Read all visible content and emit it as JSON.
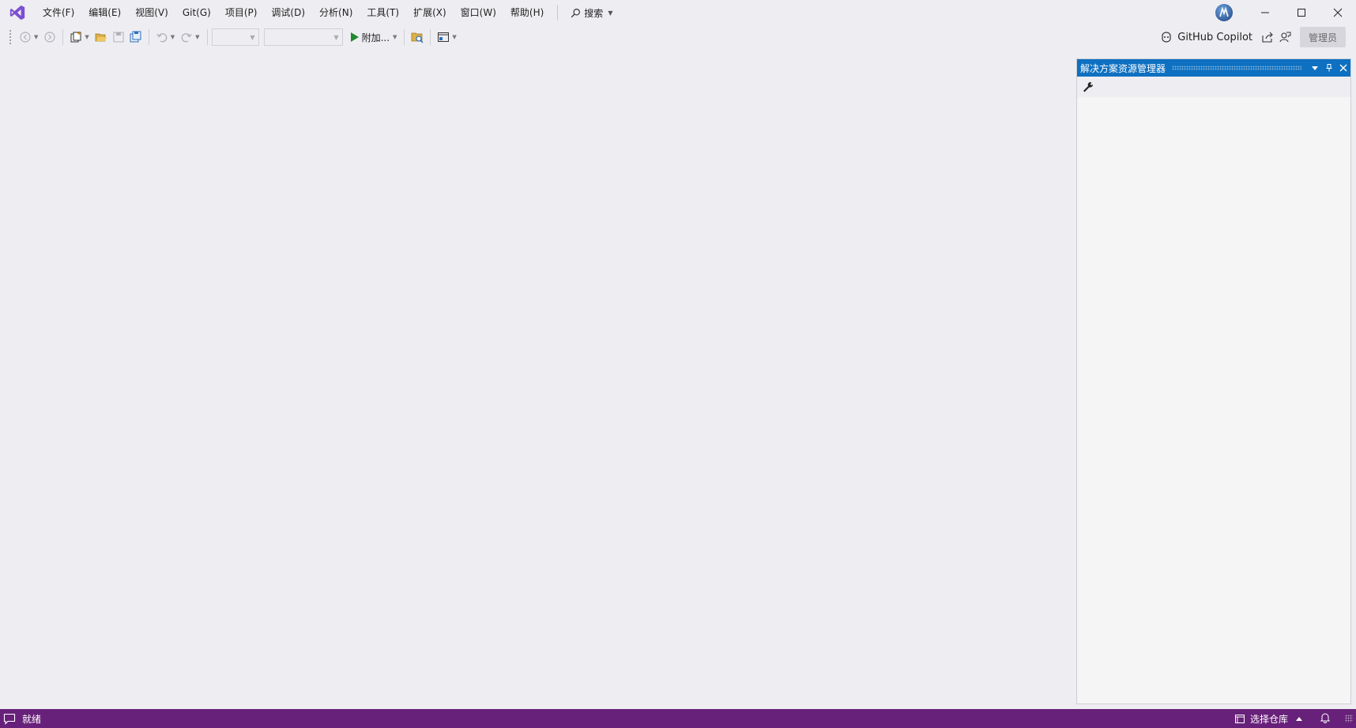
{
  "menu": {
    "items": [
      "文件(F)",
      "编辑(E)",
      "视图(V)",
      "Git(G)",
      "项目(P)",
      "调试(D)",
      "分析(N)",
      "工具(T)",
      "扩展(X)",
      "窗口(W)",
      "帮助(H)"
    ],
    "search_label": "搜索"
  },
  "toolbar": {
    "attach_label": "附加...",
    "copilot_label": "GitHub Copilot",
    "admin_label": "管理员"
  },
  "solution_explorer": {
    "title": "解决方案资源管理器"
  },
  "status": {
    "ready": "就绪",
    "select_repo": "选择仓库"
  },
  "colors": {
    "accent": "#0e70c0",
    "status_bar": "#68217a",
    "logo": "#7b4fd1",
    "run": "#1f8a2e"
  },
  "icons": [
    "vs-logo-icon",
    "search-icon",
    "user-avatar",
    "minimize-icon",
    "maximize-icon",
    "close-icon",
    "back-icon",
    "forward-icon",
    "new-project-icon",
    "open-folder-icon",
    "save-icon",
    "save-all-icon",
    "undo-icon",
    "redo-icon",
    "play-icon",
    "find-in-files-icon",
    "layout-icon",
    "copilot-icon",
    "share-icon",
    "feedback-icon",
    "wrench-icon",
    "dropdown-icon",
    "pin-icon",
    "comment-icon",
    "repo-icon",
    "bell-icon"
  ]
}
